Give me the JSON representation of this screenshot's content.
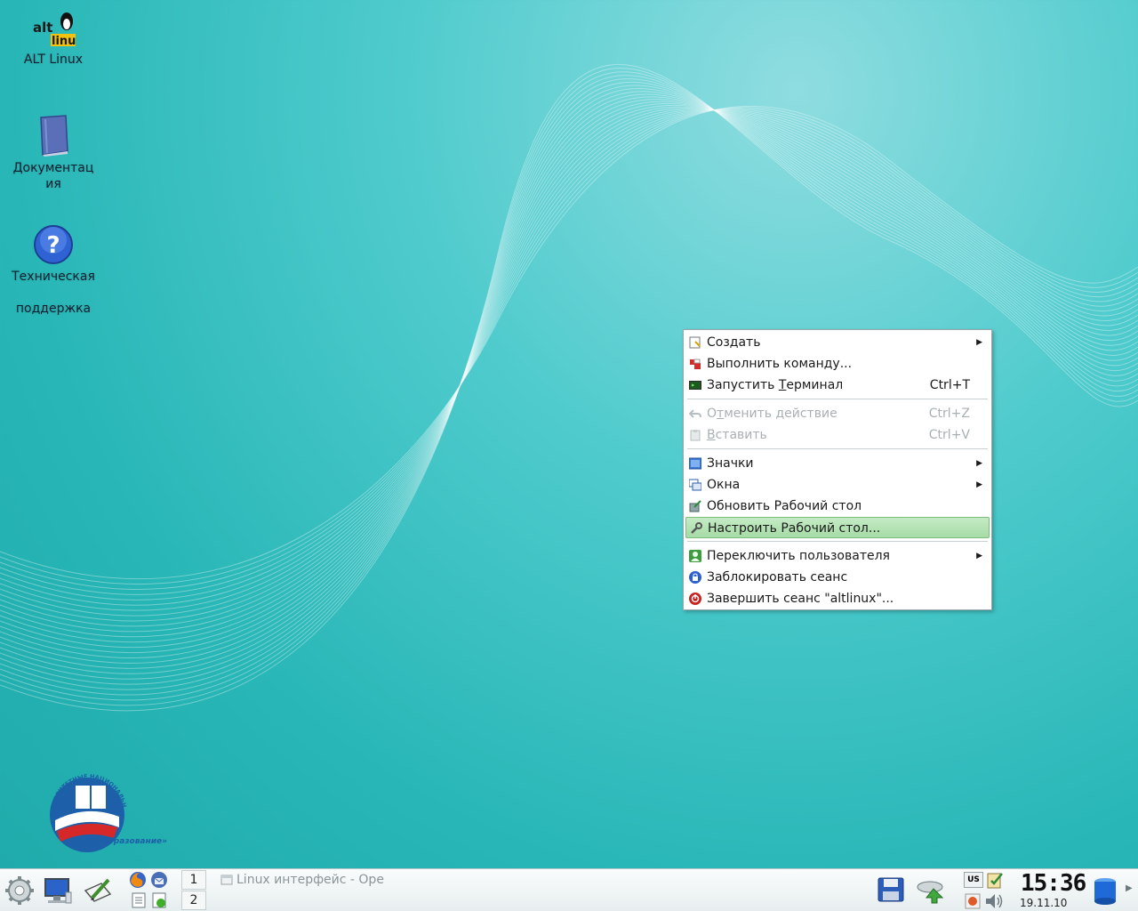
{
  "desktop": {
    "icons": [
      {
        "label": "ALT Linux",
        "logo_top": "alt",
        "logo_bottom": "linux"
      },
      {
        "label_line1": "Документац",
        "label_line2": "ия"
      },
      {
        "label_line1": "Техническая",
        "label_line2": "поддержка"
      }
    ],
    "emblem_text_top": "ПРИОРИТЕТНЫЕ НАЦИОНАЛЬНЫЕ ПРОЕКТЫ",
    "emblem_text_bottom": "«Образование»"
  },
  "context_menu": {
    "items": [
      {
        "label": "Создать",
        "submenu": true
      },
      {
        "label": "Выполнить команду..."
      },
      {
        "label_pre": "Запустить ",
        "label_ul": "Т",
        "label_post": "ерминал",
        "shortcut": "Ctrl+T"
      },
      {
        "label_pre": "О",
        "label_ul": "т",
        "label_post": "менить действие",
        "shortcut": "Ctrl+Z",
        "disabled": true
      },
      {
        "label_pre": "",
        "label_ul": "В",
        "label_post": "ставить",
        "shortcut": "Ctrl+V",
        "disabled": true
      },
      {
        "label": "Значки",
        "submenu": true
      },
      {
        "label": "Окна",
        "submenu": true
      },
      {
        "label": "Обновить Рабочий стол"
      },
      {
        "label": "Настроить Рабочий стол...",
        "highlighted": true
      },
      {
        "label": "Переключить пользователя",
        "submenu": true
      },
      {
        "label": "Заблокировать сеанс"
      },
      {
        "label": "Завершить сеанс \"altlinux\"..."
      }
    ],
    "submenu_arrow": "▶"
  },
  "taskbar": {
    "pager": [
      "1",
      "2"
    ],
    "task_title": "Linux интерфейс - Ope",
    "tray": {
      "keyboard_layout": "US"
    },
    "clock_time": "15:36",
    "clock_date": "19.11.10"
  },
  "colors": {
    "desktop_bg": "#2bb5b6",
    "menu_highlight": "#a6dba6",
    "menu_disabled_text": "#a8b0b3"
  }
}
